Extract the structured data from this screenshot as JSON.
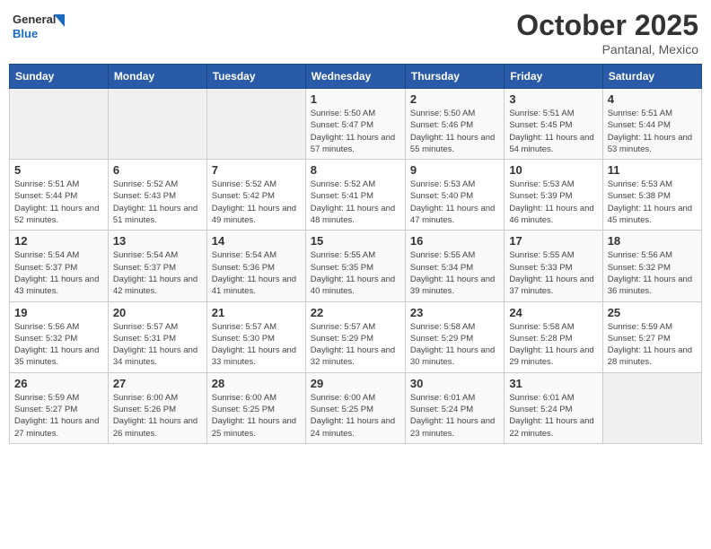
{
  "header": {
    "logo_general": "General",
    "logo_blue": "Blue",
    "month_year": "October 2025",
    "location": "Pantanal, Mexico"
  },
  "weekdays": [
    "Sunday",
    "Monday",
    "Tuesday",
    "Wednesday",
    "Thursday",
    "Friday",
    "Saturday"
  ],
  "weeks": [
    [
      {
        "day": "",
        "sunrise": "",
        "sunset": "",
        "daylight": "",
        "empty": true
      },
      {
        "day": "",
        "sunrise": "",
        "sunset": "",
        "daylight": "",
        "empty": true
      },
      {
        "day": "",
        "sunrise": "",
        "sunset": "",
        "daylight": "",
        "empty": true
      },
      {
        "day": "1",
        "sunrise": "Sunrise: 5:50 AM",
        "sunset": "Sunset: 5:47 PM",
        "daylight": "Daylight: 11 hours and 57 minutes."
      },
      {
        "day": "2",
        "sunrise": "Sunrise: 5:50 AM",
        "sunset": "Sunset: 5:46 PM",
        "daylight": "Daylight: 11 hours and 55 minutes."
      },
      {
        "day": "3",
        "sunrise": "Sunrise: 5:51 AM",
        "sunset": "Sunset: 5:45 PM",
        "daylight": "Daylight: 11 hours and 54 minutes."
      },
      {
        "day": "4",
        "sunrise": "Sunrise: 5:51 AM",
        "sunset": "Sunset: 5:44 PM",
        "daylight": "Daylight: 11 hours and 53 minutes."
      }
    ],
    [
      {
        "day": "5",
        "sunrise": "Sunrise: 5:51 AM",
        "sunset": "Sunset: 5:44 PM",
        "daylight": "Daylight: 11 hours and 52 minutes."
      },
      {
        "day": "6",
        "sunrise": "Sunrise: 5:52 AM",
        "sunset": "Sunset: 5:43 PM",
        "daylight": "Daylight: 11 hours and 51 minutes."
      },
      {
        "day": "7",
        "sunrise": "Sunrise: 5:52 AM",
        "sunset": "Sunset: 5:42 PM",
        "daylight": "Daylight: 11 hours and 49 minutes."
      },
      {
        "day": "8",
        "sunrise": "Sunrise: 5:52 AM",
        "sunset": "Sunset: 5:41 PM",
        "daylight": "Daylight: 11 hours and 48 minutes."
      },
      {
        "day": "9",
        "sunrise": "Sunrise: 5:53 AM",
        "sunset": "Sunset: 5:40 PM",
        "daylight": "Daylight: 11 hours and 47 minutes."
      },
      {
        "day": "10",
        "sunrise": "Sunrise: 5:53 AM",
        "sunset": "Sunset: 5:39 PM",
        "daylight": "Daylight: 11 hours and 46 minutes."
      },
      {
        "day": "11",
        "sunrise": "Sunrise: 5:53 AM",
        "sunset": "Sunset: 5:38 PM",
        "daylight": "Daylight: 11 hours and 45 minutes."
      }
    ],
    [
      {
        "day": "12",
        "sunrise": "Sunrise: 5:54 AM",
        "sunset": "Sunset: 5:37 PM",
        "daylight": "Daylight: 11 hours and 43 minutes."
      },
      {
        "day": "13",
        "sunrise": "Sunrise: 5:54 AM",
        "sunset": "Sunset: 5:37 PM",
        "daylight": "Daylight: 11 hours and 42 minutes."
      },
      {
        "day": "14",
        "sunrise": "Sunrise: 5:54 AM",
        "sunset": "Sunset: 5:36 PM",
        "daylight": "Daylight: 11 hours and 41 minutes."
      },
      {
        "day": "15",
        "sunrise": "Sunrise: 5:55 AM",
        "sunset": "Sunset: 5:35 PM",
        "daylight": "Daylight: 11 hours and 40 minutes."
      },
      {
        "day": "16",
        "sunrise": "Sunrise: 5:55 AM",
        "sunset": "Sunset: 5:34 PM",
        "daylight": "Daylight: 11 hours and 39 minutes."
      },
      {
        "day": "17",
        "sunrise": "Sunrise: 5:55 AM",
        "sunset": "Sunset: 5:33 PM",
        "daylight": "Daylight: 11 hours and 37 minutes."
      },
      {
        "day": "18",
        "sunrise": "Sunrise: 5:56 AM",
        "sunset": "Sunset: 5:32 PM",
        "daylight": "Daylight: 11 hours and 36 minutes."
      }
    ],
    [
      {
        "day": "19",
        "sunrise": "Sunrise: 5:56 AM",
        "sunset": "Sunset: 5:32 PM",
        "daylight": "Daylight: 11 hours and 35 minutes."
      },
      {
        "day": "20",
        "sunrise": "Sunrise: 5:57 AM",
        "sunset": "Sunset: 5:31 PM",
        "daylight": "Daylight: 11 hours and 34 minutes."
      },
      {
        "day": "21",
        "sunrise": "Sunrise: 5:57 AM",
        "sunset": "Sunset: 5:30 PM",
        "daylight": "Daylight: 11 hours and 33 minutes."
      },
      {
        "day": "22",
        "sunrise": "Sunrise: 5:57 AM",
        "sunset": "Sunset: 5:29 PM",
        "daylight": "Daylight: 11 hours and 32 minutes."
      },
      {
        "day": "23",
        "sunrise": "Sunrise: 5:58 AM",
        "sunset": "Sunset: 5:29 PM",
        "daylight": "Daylight: 11 hours and 30 minutes."
      },
      {
        "day": "24",
        "sunrise": "Sunrise: 5:58 AM",
        "sunset": "Sunset: 5:28 PM",
        "daylight": "Daylight: 11 hours and 29 minutes."
      },
      {
        "day": "25",
        "sunrise": "Sunrise: 5:59 AM",
        "sunset": "Sunset: 5:27 PM",
        "daylight": "Daylight: 11 hours and 28 minutes."
      }
    ],
    [
      {
        "day": "26",
        "sunrise": "Sunrise: 5:59 AM",
        "sunset": "Sunset: 5:27 PM",
        "daylight": "Daylight: 11 hours and 27 minutes."
      },
      {
        "day": "27",
        "sunrise": "Sunrise: 6:00 AM",
        "sunset": "Sunset: 5:26 PM",
        "daylight": "Daylight: 11 hours and 26 minutes."
      },
      {
        "day": "28",
        "sunrise": "Sunrise: 6:00 AM",
        "sunset": "Sunset: 5:25 PM",
        "daylight": "Daylight: 11 hours and 25 minutes."
      },
      {
        "day": "29",
        "sunrise": "Sunrise: 6:00 AM",
        "sunset": "Sunset: 5:25 PM",
        "daylight": "Daylight: 11 hours and 24 minutes."
      },
      {
        "day": "30",
        "sunrise": "Sunrise: 6:01 AM",
        "sunset": "Sunset: 5:24 PM",
        "daylight": "Daylight: 11 hours and 23 minutes."
      },
      {
        "day": "31",
        "sunrise": "Sunrise: 6:01 AM",
        "sunset": "Sunset: 5:24 PM",
        "daylight": "Daylight: 11 hours and 22 minutes."
      },
      {
        "day": "",
        "sunrise": "",
        "sunset": "",
        "daylight": "",
        "empty": true
      }
    ]
  ]
}
